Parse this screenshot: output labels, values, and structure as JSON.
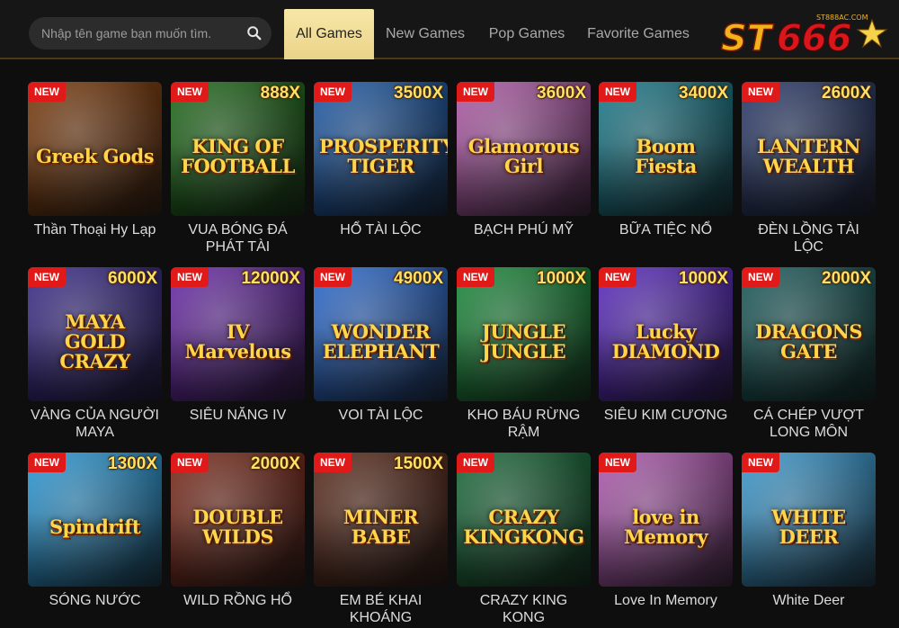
{
  "header": {
    "search_placeholder": "Nhập tên game bạn muốn tìm.",
    "tabs": [
      "All Games",
      "New Games",
      "Pop Games",
      "Favorite Games"
    ],
    "active_tab": "All Games",
    "logo_text": "ST666",
    "logo_subtext": "ST888AC.COM"
  },
  "colors": {
    "accent_gold": "#ead38a",
    "badge_red": "#e01919",
    "background": "#0e0e0e"
  },
  "games": [
    {
      "name": "Thần Thoại Hy Lạp",
      "art": "Greek Gods",
      "badge": "NEW",
      "multiplier": "",
      "bg": "#7a3a0c"
    },
    {
      "name": "VUA BÓNG ĐÁ PHÁT TÀI",
      "art": "KING OF FOOTBALL",
      "badge": "NEW",
      "multiplier": "888X",
      "bg": "#1f6a1a"
    },
    {
      "name": "HỔ TÀI LỘC",
      "art": "PROSPERITY TIGER",
      "badge": "NEW",
      "multiplier": "3500X",
      "bg": "#1d5aa8"
    },
    {
      "name": "BẠCH PHÚ MỸ",
      "art": "Glamorous Girl",
      "badge": "NEW",
      "multiplier": "3600X",
      "bg": "#b05aa8"
    },
    {
      "name": "BỮA TIỆC NỔ",
      "art": "Boom Fiesta",
      "badge": "NEW",
      "multiplier": "3400X",
      "bg": "#1a7a8a"
    },
    {
      "name": "ĐÈN LỒNG TÀI LỘC",
      "art": "LANTERN WEALTH",
      "badge": "NEW",
      "multiplier": "2600X",
      "bg": "#2a3a6a"
    },
    {
      "name": "VÀNG CỦA NGƯỜI MAYA",
      "art": "MAYA GOLD CRAZY",
      "badge": "NEW",
      "multiplier": "6000X",
      "bg": "#3a2a8a"
    },
    {
      "name": "SIÊU NĂNG IV",
      "art": "IV Marvelous",
      "badge": "NEW",
      "multiplier": "12000X",
      "bg": "#6a2aa8"
    },
    {
      "name": "VOI TÀI LỘC",
      "art": "WONDER ELEPHANT",
      "badge": "NEW",
      "multiplier": "4900X",
      "bg": "#2a6ad0"
    },
    {
      "name": "KHO BÁU RỪNG RẬM",
      "art": "JUNGLE JUNGLE",
      "badge": "NEW",
      "multiplier": "1000X",
      "bg": "#1a8a3a"
    },
    {
      "name": "SIÊU KIM CƯƠNG",
      "art": "Lucky DIAMOND",
      "badge": "NEW",
      "multiplier": "1000X",
      "bg": "#5a2ac0"
    },
    {
      "name": "CÁ CHÉP VƯỢT LONG MÔN",
      "art": "DRAGONS GATE",
      "badge": "NEW",
      "multiplier": "2000X",
      "bg": "#1a5a5a"
    },
    {
      "name": "SÓNG NƯỚC",
      "art": "Spindrift",
      "badge": "NEW",
      "multiplier": "1300X",
      "bg": "#2a9ad8"
    },
    {
      "name": "WILD RỒNG HỔ",
      "art": "DOUBLE WILDS",
      "badge": "NEW",
      "multiplier": "2000X",
      "bg": "#7a2a1a"
    },
    {
      "name": "EM BÉ KHAI KHOÁNG",
      "art": "MINER BABE",
      "badge": "NEW",
      "multiplier": "1500X",
      "bg": "#5a2a1a"
    },
    {
      "name": "CRAZY KING KONG",
      "art": "CRAZY KINGKONG",
      "badge": "NEW",
      "multiplier": "",
      "bg": "#1a6a3a"
    },
    {
      "name": "Love In Memory",
      "art": "love in Memory",
      "badge": "NEW",
      "multiplier": "",
      "bg": "#b05ab0"
    },
    {
      "name": "White Deer",
      "art": "WHITE DEER",
      "badge": "NEW",
      "multiplier": "",
      "bg": "#3a9ad0"
    }
  ]
}
